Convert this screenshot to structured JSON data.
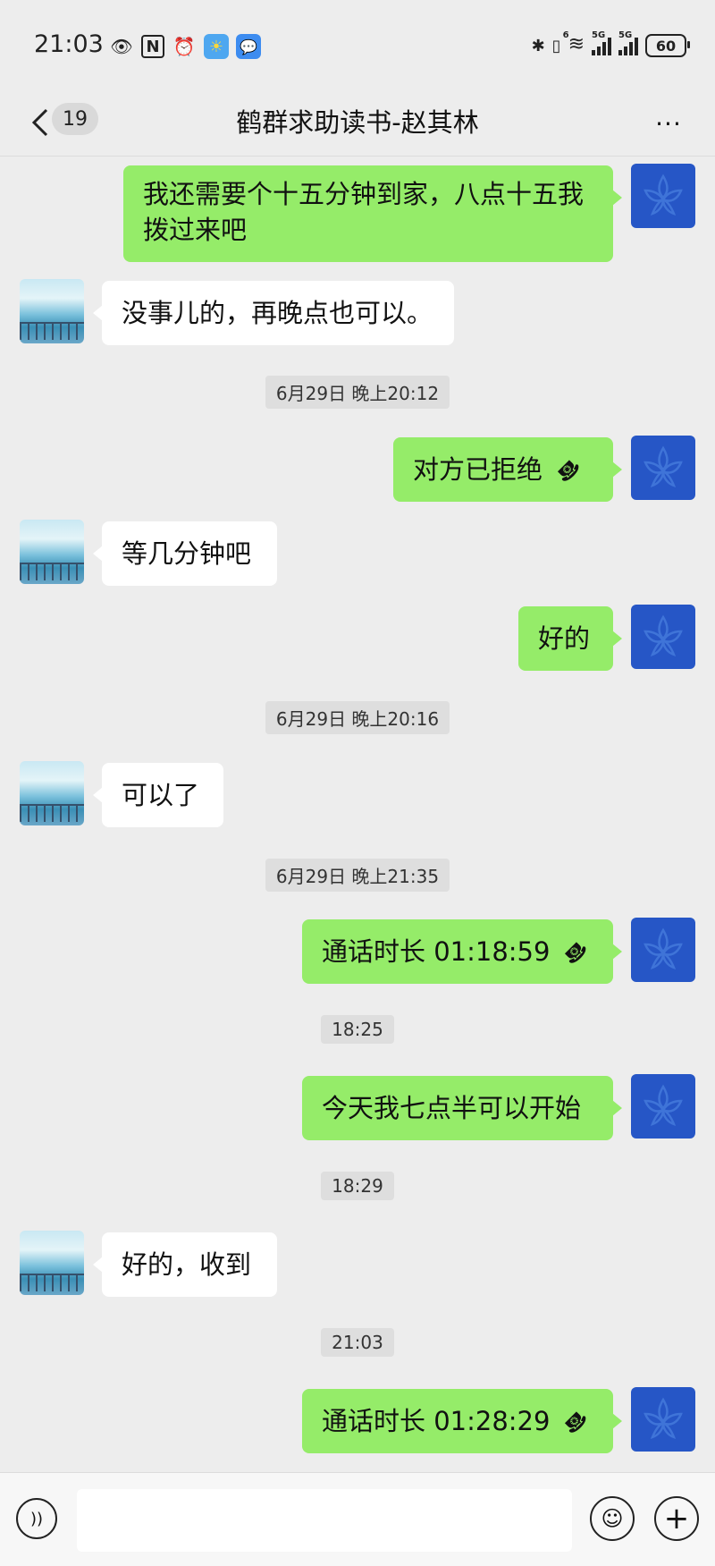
{
  "status_bar": {
    "time": "21:03",
    "battery": "60",
    "signal_1": "5G",
    "signal_2": "5G",
    "wifi_tag": "6"
  },
  "header": {
    "unread_count": "19",
    "title": "鹤群求助读书-赵其林",
    "more": "···"
  },
  "messages": [
    {
      "from": "me",
      "text": "我还需要个十五分钟到家，八点十五我拨过来吧"
    },
    {
      "from": "other",
      "text": "没事儿的，再晚点也可以。"
    },
    {
      "timestamp": "6月29日 晚上20:12"
    },
    {
      "from": "me",
      "text": "对方已拒绝",
      "icon": "phone-hangup-icon"
    },
    {
      "from": "other",
      "text": "等几分钟吧"
    },
    {
      "from": "me",
      "text": "好的"
    },
    {
      "timestamp": "6月29日 晚上20:16"
    },
    {
      "from": "other",
      "text": "可以了"
    },
    {
      "timestamp": "6月29日 晚上21:35"
    },
    {
      "from": "me",
      "text": "通话时长 01:18:59",
      "icon": "phone-hangup-icon"
    },
    {
      "timestamp": "18:25"
    },
    {
      "from": "me",
      "text": "今天我七点半可以开始"
    },
    {
      "timestamp": "18:29"
    },
    {
      "from": "other",
      "text": "好的，收到"
    },
    {
      "timestamp": "21:03"
    },
    {
      "from": "me",
      "text": "通话时长 01:28:29",
      "icon": "phone-hangup-icon"
    }
  ],
  "input_bar": {
    "value": "",
    "placeholder": ""
  },
  "colors": {
    "background": "#ededed",
    "my_bubble": "#95ec69",
    "other_bubble": "#ffffff",
    "my_avatar": "#2656c6"
  }
}
